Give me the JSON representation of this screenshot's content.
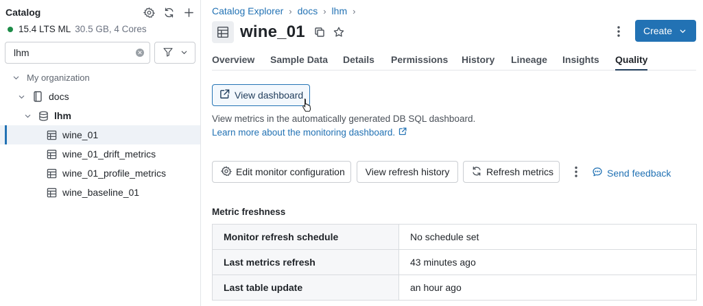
{
  "sidebar": {
    "title": "Catalog",
    "cluster": {
      "name": "15.4 LTS ML",
      "spec": "30.5 GB, 4 Cores",
      "status_color": "#1e8c48"
    },
    "search": {
      "value": "lhm"
    },
    "tree": {
      "org": "My organization",
      "catalog": "docs",
      "schema": "lhm",
      "tables": [
        "wine_01",
        "wine_01_drift_metrics",
        "wine_01_profile_metrics",
        "wine_baseline_01"
      ]
    }
  },
  "header": {
    "breadcrumbs": [
      "Catalog Explorer",
      "docs",
      "lhm"
    ],
    "title": "wine_01",
    "create_label": "Create",
    "accent_color": "#2272b4"
  },
  "tabs": [
    "Overview",
    "Sample Data",
    "Details",
    "Permissions",
    "History",
    "Lineage",
    "Insights",
    "Quality"
  ],
  "active_tab": "Quality",
  "quality": {
    "view_dashboard_label": "View dashboard",
    "description": "View metrics in the automatically generated DB SQL dashboard.",
    "learn_more": "Learn more about the monitoring dashboard.",
    "actions": {
      "edit_monitor": "Edit monitor configuration",
      "view_refresh_history": "View refresh history",
      "refresh_metrics": "Refresh metrics",
      "send_feedback": "Send feedback"
    },
    "freshness": {
      "title": "Metric freshness",
      "rows": [
        {
          "label": "Monitor refresh schedule",
          "value": "No schedule set"
        },
        {
          "label": "Last metrics refresh",
          "value": "43 minutes ago"
        },
        {
          "label": "Last table update",
          "value": "an hour ago"
        }
      ]
    }
  }
}
